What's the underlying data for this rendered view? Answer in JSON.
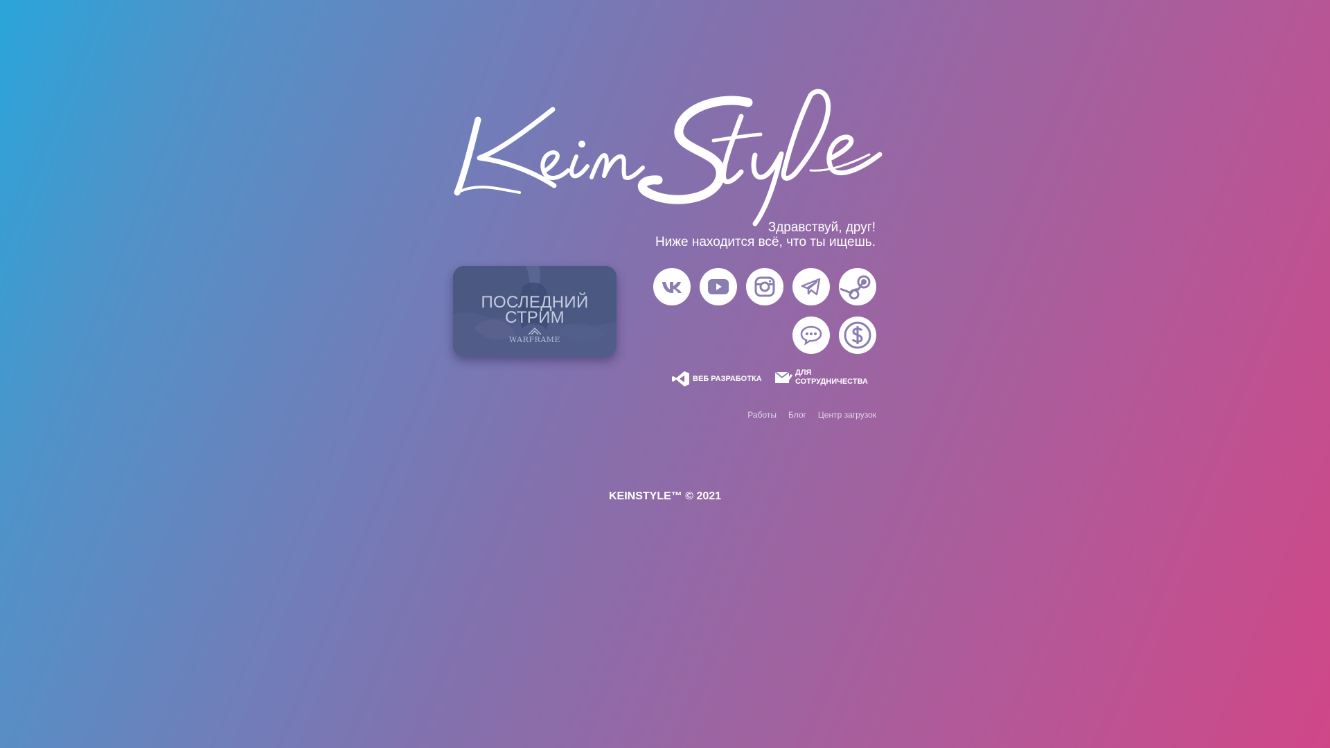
{
  "logo": {
    "text": "KeinStyle"
  },
  "greeting": {
    "line1": "Здравствуй, друг!",
    "line2": "Ниже находится всё, что ты ищешь."
  },
  "stream_card": {
    "title_line1": "ПОСЛЕДНИЙ",
    "title_line2": "СТРИМ",
    "game": "WARFRAME"
  },
  "social": [
    {
      "name": "vk",
      "icon": "vk-icon"
    },
    {
      "name": "youtube",
      "icon": "youtube-icon"
    },
    {
      "name": "instagram",
      "icon": "instagram-icon"
    },
    {
      "name": "telegram",
      "icon": "telegram-icon"
    },
    {
      "name": "steam",
      "icon": "steam-icon"
    },
    {
      "name": "chat",
      "icon": "chat-icon"
    },
    {
      "name": "donate",
      "icon": "dollar-icon"
    }
  ],
  "links": {
    "webdev": "ВЕБ РАЗРАБОТКА",
    "coop_line1": "ДЛЯ",
    "coop_line2": "СОТРУДНИЧЕСТВА"
  },
  "nav": {
    "works": "Работы",
    "blog": "Блог",
    "downloads": "Центр загрузок"
  },
  "footer": {
    "text": "KEINSTYLE™ © 2021"
  },
  "colors": {
    "gradient_start": "#2aa5da",
    "gradient_end": "#d04788",
    "icon_fill": "#ffffff",
    "icon_glyph": "#8a7db0"
  }
}
